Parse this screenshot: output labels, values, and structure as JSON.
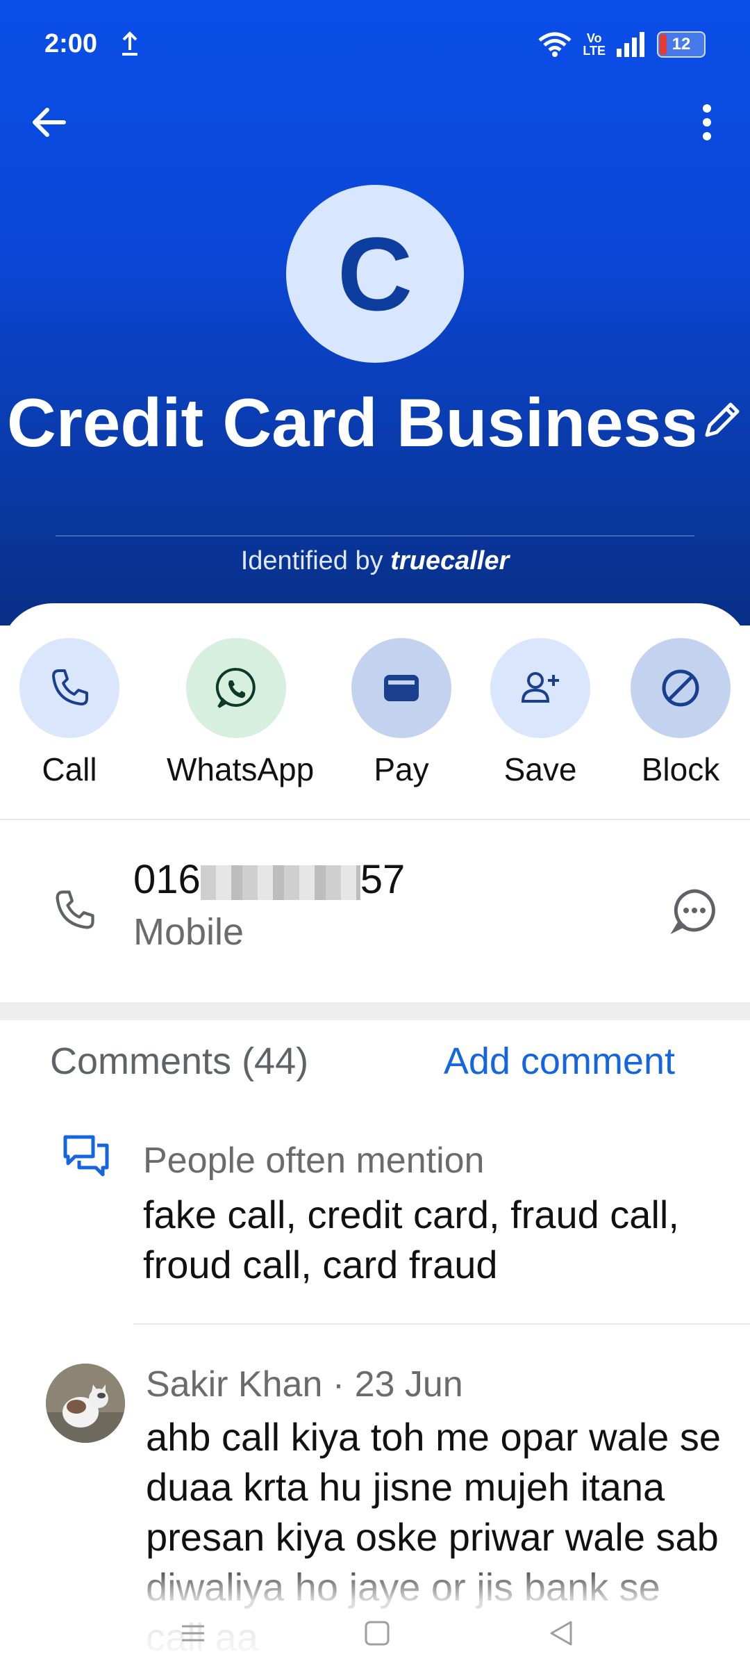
{
  "status_bar": {
    "time": "2:00",
    "volte_top": "Vo",
    "volte_bottom": "LTE",
    "battery": "12"
  },
  "contact": {
    "avatar_letter": "C",
    "name": "Credit Card Business",
    "identified_prefix": "Identified by",
    "identified_brand": "truecaller"
  },
  "actions": [
    {
      "label": "Call",
      "icon": "phone-icon",
      "bg": "#d9e6fb"
    },
    {
      "label": "WhatsApp",
      "icon": "whatsapp-icon",
      "bg": "#d7efdf"
    },
    {
      "label": "Pay",
      "icon": "wallet-icon",
      "bg": "#c3d3ef"
    },
    {
      "label": "Save",
      "icon": "add-person-icon",
      "bg": "#d9e6fb"
    },
    {
      "label": "Block",
      "icon": "block-icon",
      "bg": "#c3d3ef"
    }
  ],
  "phone": {
    "prefix": "016",
    "suffix": "57",
    "type": "Mobile"
  },
  "comments": {
    "header": "Comments (44)",
    "add_label": "Add comment",
    "mention_title": "People often mention",
    "mention_text": "fake call, credit card, fraud call, froud call, card fraud",
    "items": [
      {
        "author_date": "Sakir Khan · 23 Jun",
        "text": "ahb call kiya toh me opar wale se duaa krta hu jisne mujeh itana presan kiya oske priwar wale sab diwaliya ho jaye or jis bank se call aa"
      }
    ]
  },
  "colors": {
    "accent": "#1565e0",
    "hero_top": "#0a4ee8",
    "hero_bottom": "#082f86"
  }
}
